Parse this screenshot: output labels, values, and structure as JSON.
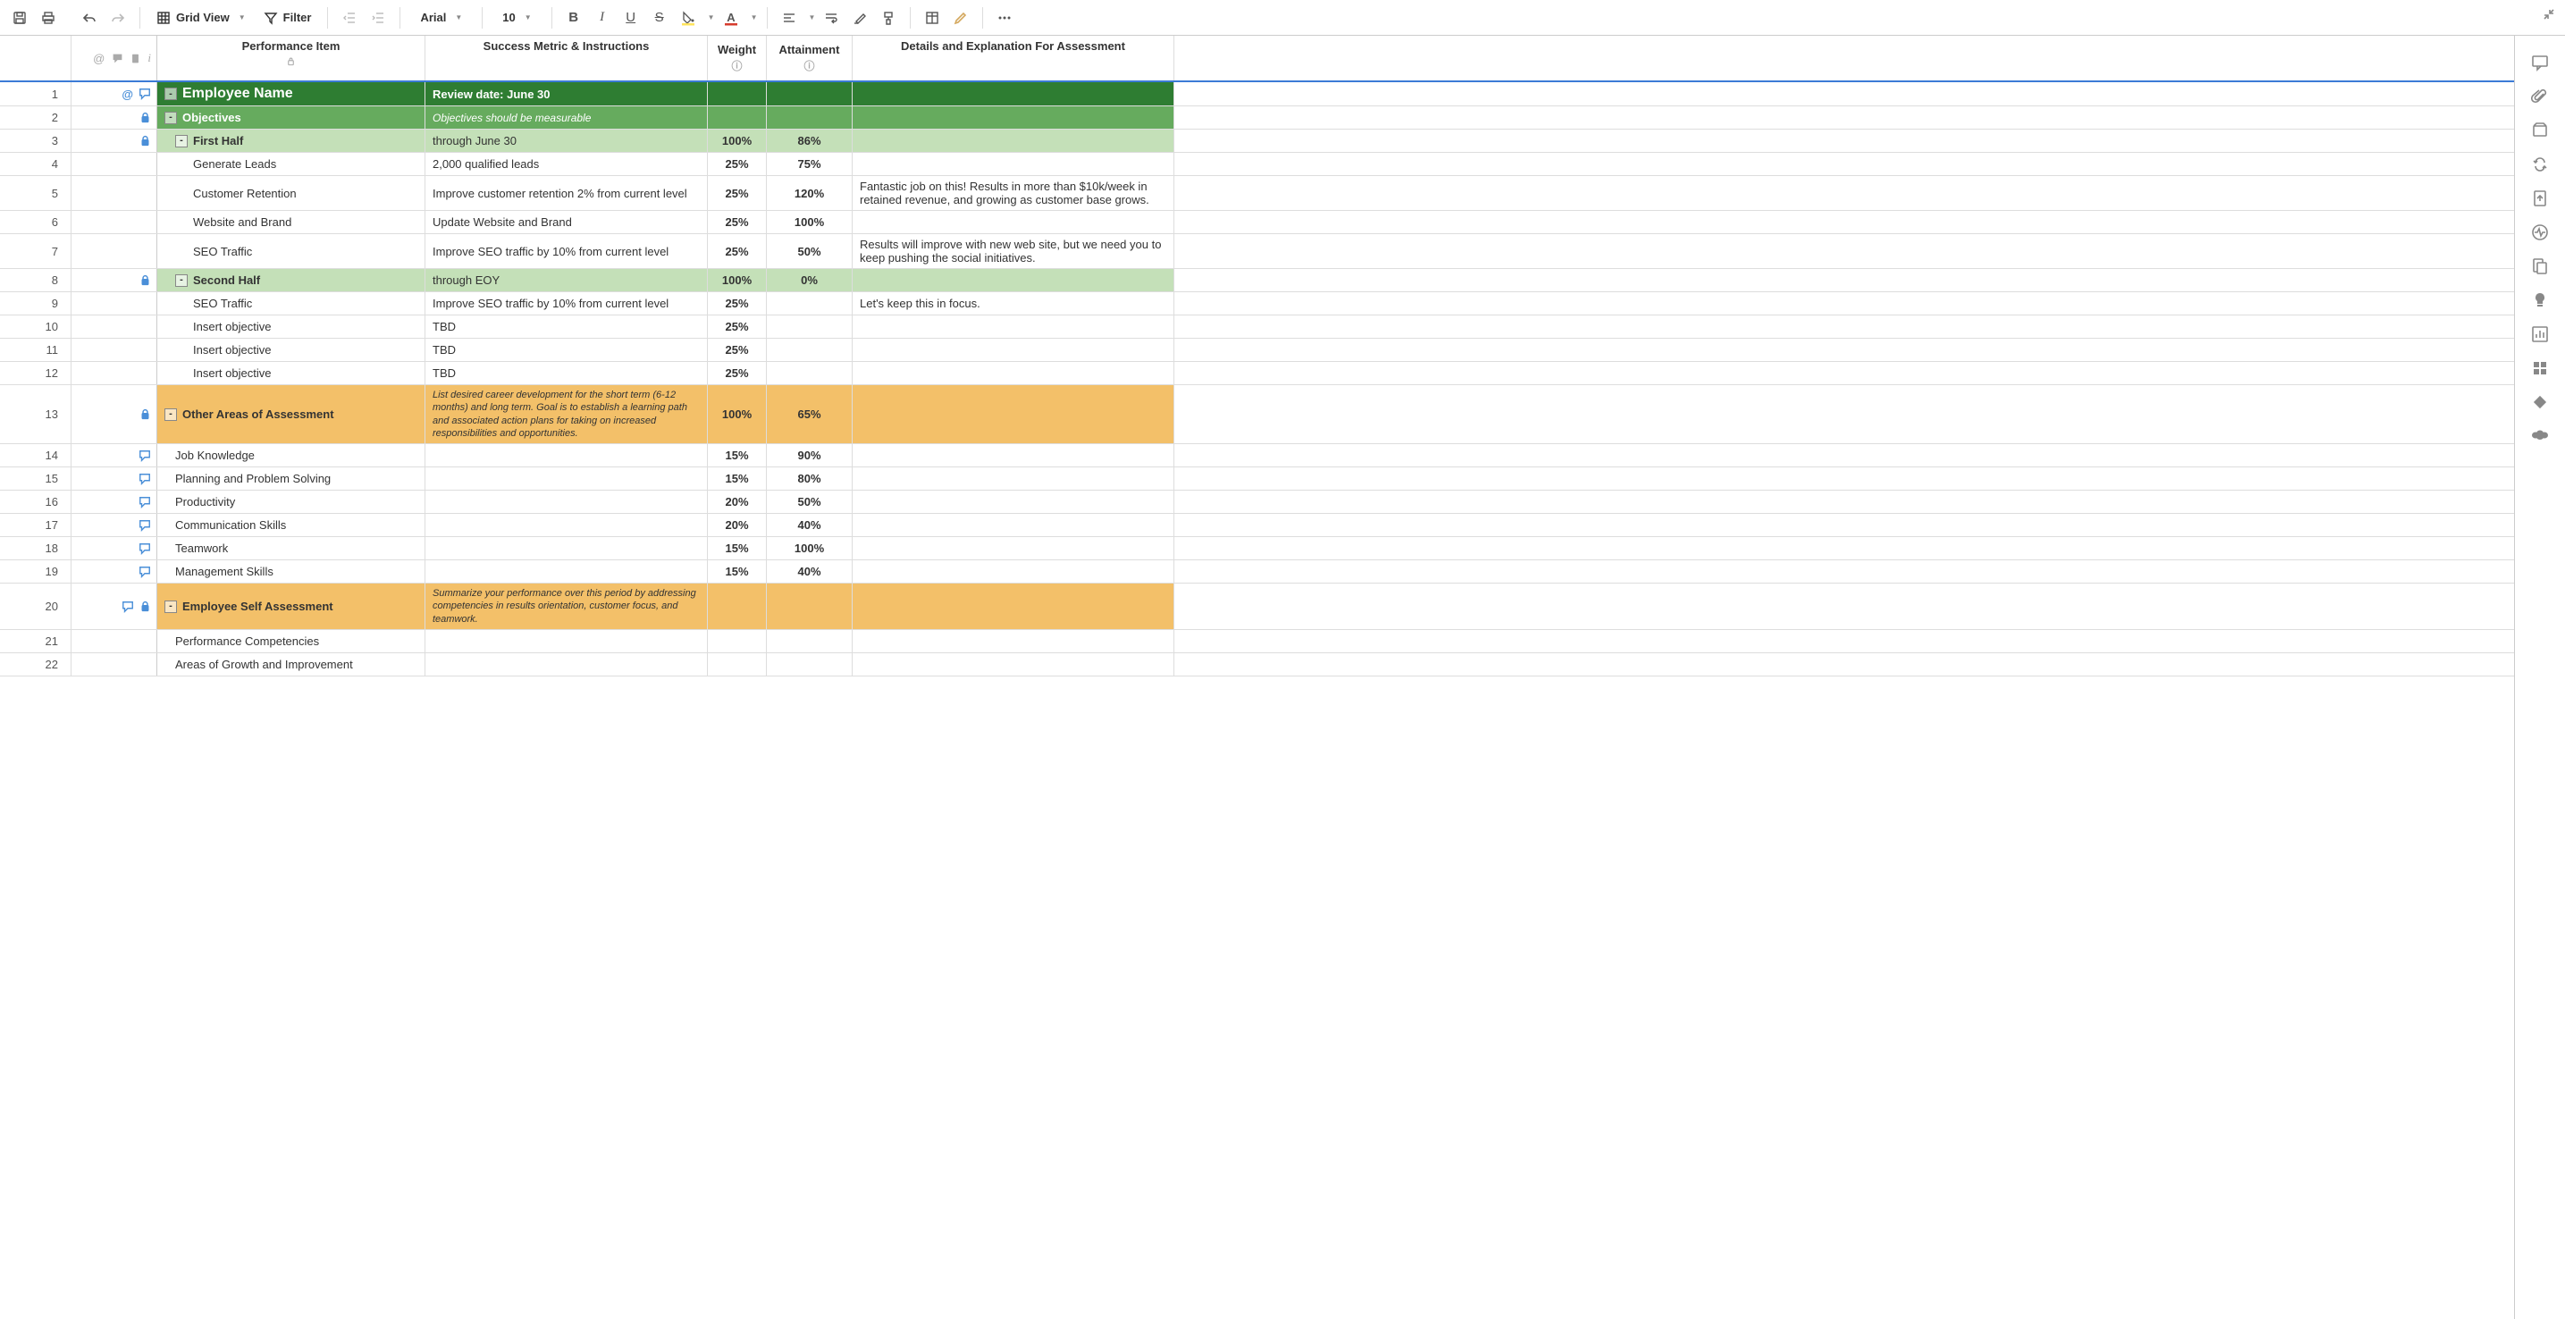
{
  "toolbar": {
    "grid_view": "Grid View",
    "filter": "Filter",
    "font": "Arial",
    "size": "10"
  },
  "headers": {
    "primary": "Performance Item",
    "metric": "Success Metric & Instructions",
    "weight": "Weight",
    "attainment": "Attainment",
    "details": "Details and Explanation For Assessment"
  },
  "rows": [
    {
      "num": "1",
      "icons": [
        "at",
        "comment"
      ],
      "style": "darkgreen",
      "expand": "-",
      "indent": 0,
      "primary": "Employee Name",
      "metric": "Review date: June 30",
      "weight": "",
      "attain": "",
      "details": "",
      "metric_bold": true
    },
    {
      "num": "2",
      "icons": [
        "lock"
      ],
      "style": "green",
      "expand": "-",
      "indent": 0,
      "primary": "Objectives",
      "metric": "Objectives should be measurable",
      "metric_italic": true,
      "weight": "",
      "attain": "",
      "details": ""
    },
    {
      "num": "3",
      "icons": [
        "lock"
      ],
      "style": "ltgreen",
      "expand": "-",
      "indent": 1,
      "primary": "First Half",
      "metric": "through June 30",
      "weight": "100%",
      "attain": "86%",
      "details": ""
    },
    {
      "num": "4",
      "icons": [],
      "style": "",
      "indent": 2,
      "primary": "Generate Leads",
      "metric": "2,000 qualified leads",
      "weight": "25%",
      "attain": "75%",
      "details": ""
    },
    {
      "num": "5",
      "icons": [],
      "style": "",
      "indent": 2,
      "primary": "Customer Retention",
      "metric": "Improve customer retention 2% from current level",
      "weight": "25%",
      "attain": "120%",
      "details": "Fantastic job on this! Results in more than $10k/week in retained revenue, and growing as customer base grows."
    },
    {
      "num": "6",
      "icons": [],
      "style": "",
      "indent": 2,
      "primary": "Website and Brand",
      "metric": "Update Website and Brand",
      "weight": "25%",
      "attain": "100%",
      "details": ""
    },
    {
      "num": "7",
      "icons": [],
      "style": "",
      "indent": 2,
      "primary": "SEO Traffic",
      "metric": "Improve SEO traffic by 10% from current level",
      "weight": "25%",
      "attain": "50%",
      "details": "Results will improve with new web site, but we need you to keep pushing the social initiatives."
    },
    {
      "num": "8",
      "icons": [
        "lock"
      ],
      "style": "ltgreen",
      "expand": "-",
      "indent": 1,
      "primary": "Second Half",
      "metric": "through EOY",
      "weight": "100%",
      "attain": "0%",
      "details": ""
    },
    {
      "num": "9",
      "icons": [],
      "style": "",
      "indent": 2,
      "primary": "SEO Traffic",
      "metric": "Improve SEO traffic by 10% from current level",
      "weight": "25%",
      "attain": "",
      "details": "Let's keep this in focus."
    },
    {
      "num": "10",
      "icons": [],
      "style": "",
      "indent": 2,
      "primary": "Insert objective",
      "metric": "TBD",
      "weight": "25%",
      "attain": "",
      "details": ""
    },
    {
      "num": "11",
      "icons": [],
      "style": "",
      "indent": 2,
      "primary": "Insert objective",
      "metric": "TBD",
      "weight": "25%",
      "attain": "",
      "details": ""
    },
    {
      "num": "12",
      "icons": [],
      "style": "",
      "indent": 2,
      "primary": "Insert objective",
      "metric": "TBD",
      "weight": "25%",
      "attain": "",
      "details": ""
    },
    {
      "num": "13",
      "icons": [
        "lock"
      ],
      "style": "orange",
      "expand": "-",
      "indent": 0,
      "primary": "Other Areas of Assessment",
      "metric": "List desired career development for the short term (6-12 months) and long term. Goal is to establish a learning path and associated action plans for taking on increased responsibilities and opportunities.",
      "metric_small": true,
      "metric_italic": true,
      "weight": "100%",
      "attain": "65%",
      "details": ""
    },
    {
      "num": "14",
      "icons": [
        "comment"
      ],
      "style": "",
      "indent": 1,
      "primary": "Job Knowledge",
      "metric": "",
      "weight": "15%",
      "attain": "90%",
      "details": ""
    },
    {
      "num": "15",
      "icons": [
        "comment"
      ],
      "style": "",
      "indent": 1,
      "primary": "Planning and Problem Solving",
      "metric": "",
      "weight": "15%",
      "attain": "80%",
      "details": ""
    },
    {
      "num": "16",
      "icons": [
        "comment"
      ],
      "style": "",
      "indent": 1,
      "primary": "Productivity",
      "metric": "",
      "weight": "20%",
      "attain": "50%",
      "details": ""
    },
    {
      "num": "17",
      "icons": [
        "comment"
      ],
      "style": "",
      "indent": 1,
      "primary": "Communication Skills",
      "metric": "",
      "weight": "20%",
      "attain": "40%",
      "details": ""
    },
    {
      "num": "18",
      "icons": [
        "comment"
      ],
      "style": "",
      "indent": 1,
      "primary": "Teamwork",
      "metric": "",
      "weight": "15%",
      "attain": "100%",
      "details": ""
    },
    {
      "num": "19",
      "icons": [
        "comment"
      ],
      "style": "",
      "indent": 1,
      "primary": "Management Skills",
      "metric": "",
      "weight": "15%",
      "attain": "40%",
      "details": ""
    },
    {
      "num": "20",
      "icons": [
        "comment",
        "lock"
      ],
      "style": "orange",
      "expand": "-",
      "indent": 0,
      "primary": "Employee Self Assessment",
      "metric": "Summarize your performance over this period by addressing competencies in results orientation, customer focus, and teamwork.",
      "metric_small": true,
      "metric_italic": true,
      "weight": "",
      "attain": "",
      "details": ""
    },
    {
      "num": "21",
      "icons": [],
      "style": "",
      "indent": 1,
      "primary": "Performance Competencies",
      "metric": "",
      "weight": "",
      "attain": "",
      "details": ""
    },
    {
      "num": "22",
      "icons": [],
      "style": "",
      "indent": 1,
      "primary": "Areas of Growth and Improvement",
      "metric": "",
      "weight": "",
      "attain": "",
      "details": ""
    }
  ]
}
